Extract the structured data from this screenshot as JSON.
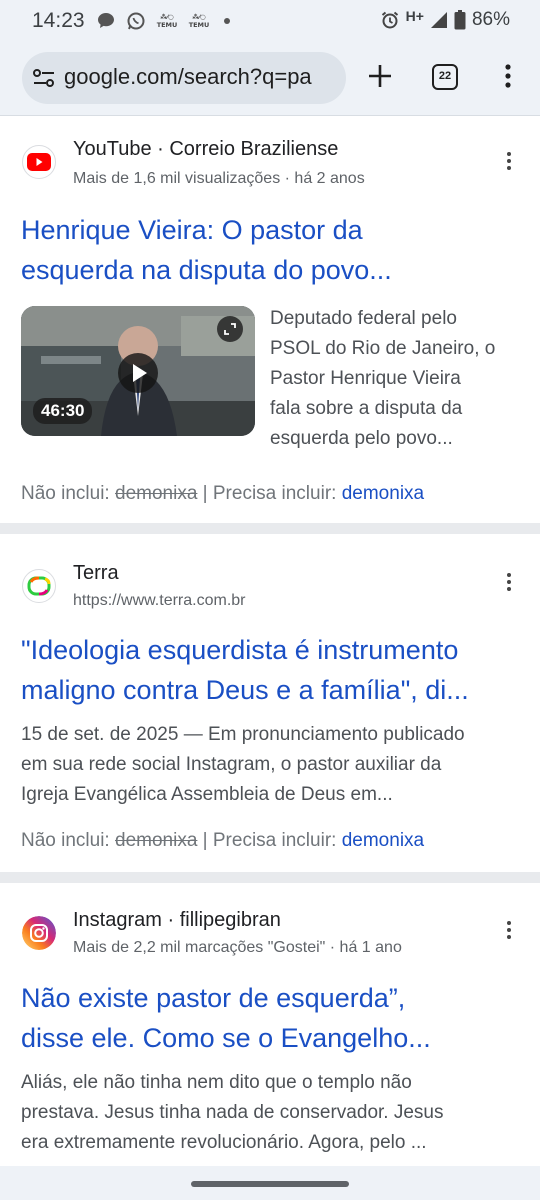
{
  "status_bar": {
    "time": "14:23",
    "network": "H+",
    "battery": "86%",
    "temu_label": "TEMU",
    "icons": [
      "chat-bubble-icon",
      "whatsapp-icon",
      "temu-icon",
      "temu-icon",
      "notification-dot-icon",
      "alarm-icon",
      "signal-icon",
      "battery-icon"
    ]
  },
  "browser": {
    "url": "google.com/search?q=pa",
    "tab_count": "22"
  },
  "results": [
    {
      "source": "YouTube · Correio Braziliense",
      "meta": "Mais de 1,6 mil visualizações · há 2 anos",
      "title_line1": "Henrique Vieira: O pastor da",
      "title_line2": "esquerda na disputa do povo...",
      "snippet_lines": [
        "Deputado federal pelo",
        "PSOL do Rio de Janeiro, o",
        "Pastor Henrique Vieira",
        "fala sobre a disputa da",
        "esquerda pelo povo..."
      ],
      "video_duration": "46:30",
      "excluded_label": "Não inclui:",
      "excluded_term": "demonixa",
      "required_label": "| Precisa incluir:",
      "required_term": "demonixa"
    },
    {
      "source": "Terra",
      "meta": "https://www.terra.com.br",
      "title_line1": "\"Ideologia esquerdista é instrumento",
      "title_line2": "maligno contra Deus e a família\", di...",
      "snippet_lines": [
        "15 de set. de 2025 — Em pronunciamento publicado",
        "em sua rede social Instagram, o pastor auxiliar da",
        "Igreja Evangélica Assembleia de Deus em..."
      ],
      "excluded_label": "Não inclui:",
      "excluded_term": "demonixa",
      "required_label": "| Precisa incluir:",
      "required_term": "demonixa"
    },
    {
      "source": "Instagram · fillipegibran",
      "meta": "Mais de 2,2 mil marcações \"Gostei\" · há 1 ano",
      "title_line1": "Não existe pastor de esquerda”,",
      "title_line2": "disse ele. Como se o Evangelho...",
      "snippet_lines": [
        "Aliás, ele não tinha nem dito que o templo não",
        "prestava. Jesus tinha nada de conservador. Jesus",
        "era extremamente revolucionário. Agora, pelo ..."
      ]
    }
  ],
  "colors": {
    "link": "#1a4fc4",
    "snippet": "#4d5156",
    "muted": "#70757a",
    "chrome_bg": "#eef2f7",
    "youtube_red": "#ff0000"
  }
}
